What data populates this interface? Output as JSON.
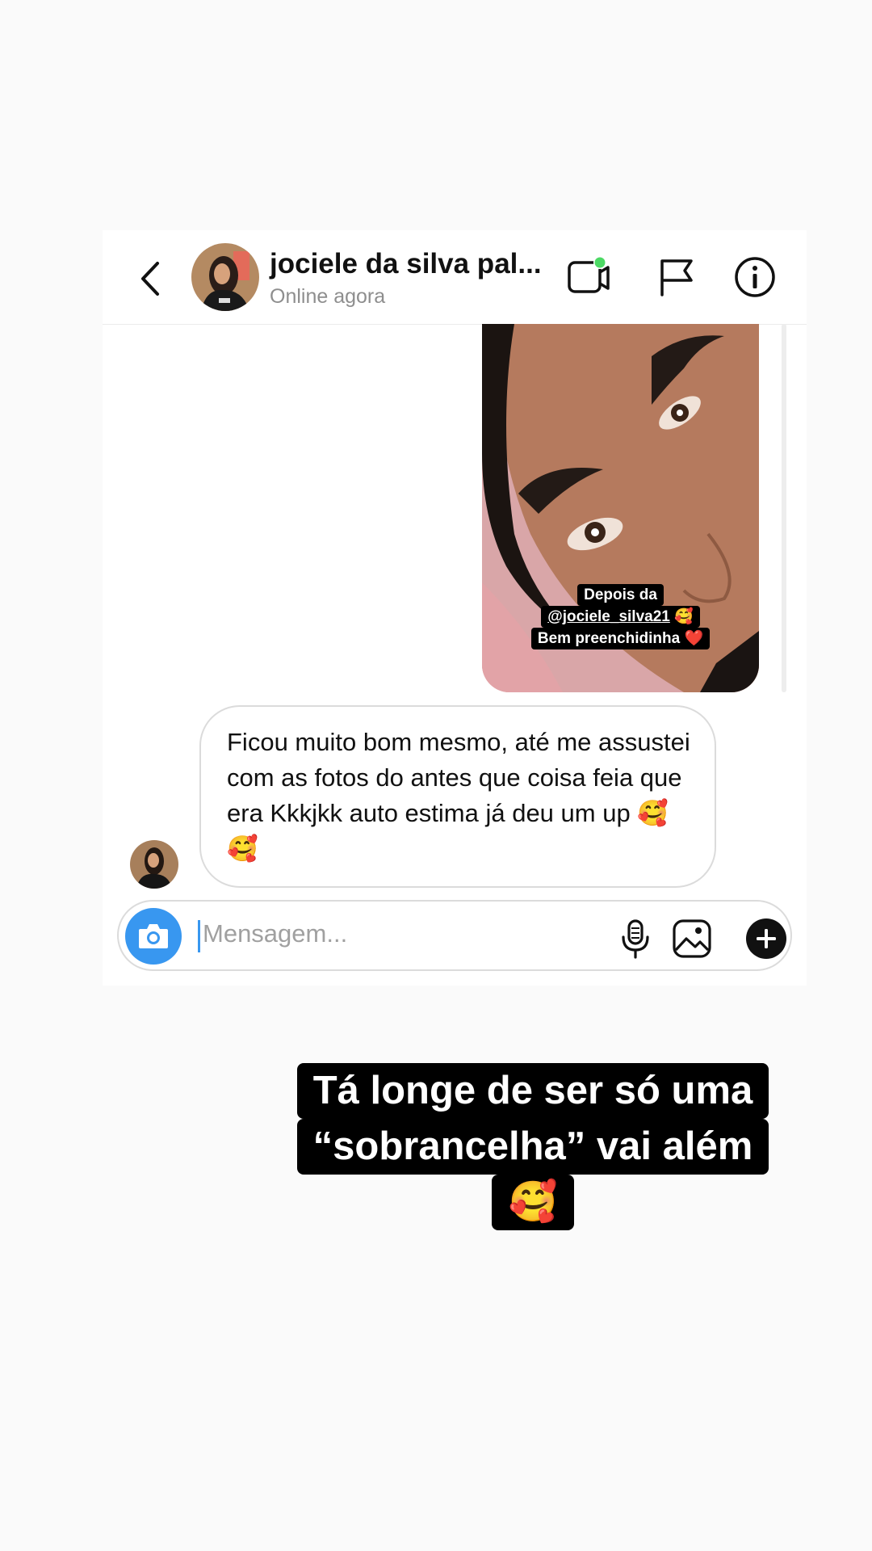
{
  "header": {
    "contact_name": "jociele da silva pal...",
    "status": "Online agora",
    "icons": [
      "back-icon",
      "video-call-icon",
      "flag-icon",
      "info-icon"
    ]
  },
  "shared_photo": {
    "caption_line1": "Depois da",
    "caption_link": "@jociele_silva21",
    "caption_emoji1": "🥰",
    "caption_line3": "Bem preenchidinha",
    "caption_emoji2": "❤️"
  },
  "message": {
    "text": "Ficou muito bom mesmo, até me assustei com as fotos do antes que coisa feia que era Kkkjkk auto estima já deu um up 🥰 🥰"
  },
  "composer": {
    "placeholder": "Mensagem...",
    "icons": [
      "camera-icon",
      "microphone-icon",
      "gallery-icon",
      "plus-icon"
    ]
  },
  "story_text": {
    "line1": "Tá longe de ser só uma",
    "line2": "“sobrancelha” vai além",
    "line3": "🥰"
  },
  "colors": {
    "accent": "#3897f0",
    "online": "#4cd964",
    "caption_bg": "#000000",
    "photo_bg": "#e9a6ac"
  }
}
